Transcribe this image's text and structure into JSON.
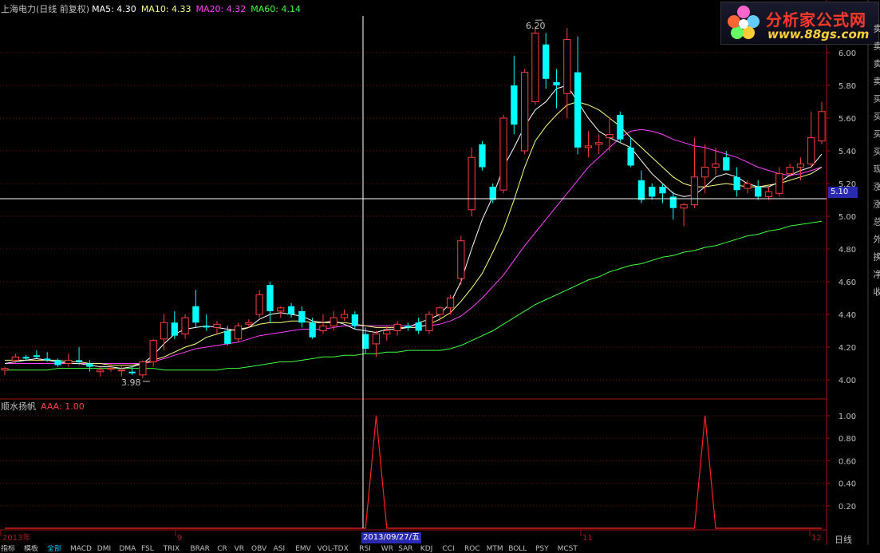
{
  "header": {
    "title": "上海电力(日线 前复权)",
    "ma5": "MA5: 4.30",
    "ma10": "MA10: 4.33",
    "ma20": "MA20: 4.32",
    "ma60": "MA60: 4.14"
  },
  "indicator": {
    "name": "顺水扬帆",
    "value": "AAA: 1.00"
  },
  "logo": {
    "brand": "分析家公式网",
    "url": "www.88gs.com"
  },
  "labels": {
    "high": "6.20",
    "low": "3.98",
    "cursor_price": "5.10",
    "cursor_date": "2013/09/27/五",
    "period": "日线"
  },
  "time_axis": [
    "2013年",
    "9",
    "11",
    "12"
  ],
  "price_axis": [
    "6.00",
    "5.80",
    "5.60",
    "5.40",
    "5.20",
    "5.00",
    "4.80",
    "4.60",
    "4.40",
    "4.20",
    "4.00"
  ],
  "indicator_axis": [
    "1.00",
    "0.80",
    "0.60",
    "0.40",
    "0.20"
  ],
  "side_labels": [
    "卖",
    "卖",
    "卖",
    "卖",
    "买",
    "买",
    "买",
    "买",
    "现",
    "涨",
    "涨",
    "总",
    "外",
    "换",
    "净",
    "收"
  ],
  "bottom_tabs": [
    {
      "label": "指标",
      "selected": false
    },
    {
      "label": "模板",
      "selected": false
    },
    {
      "label": "全部",
      "selected": true
    },
    {
      "label": "MACD",
      "selected": false
    },
    {
      "label": "DMI",
      "selected": false
    },
    {
      "label": "DMA",
      "selected": false
    },
    {
      "label": "FSL",
      "selected": false
    },
    {
      "label": "TRIX",
      "selected": false
    },
    {
      "label": "BRAR",
      "selected": false
    },
    {
      "label": "CR",
      "selected": false
    },
    {
      "label": "VR",
      "selected": false
    },
    {
      "label": "OBV",
      "selected": false
    },
    {
      "label": "ASI",
      "selected": false
    },
    {
      "label": "EMV",
      "selected": false
    },
    {
      "label": "VOL-TDX",
      "selected": false
    },
    {
      "label": "RSI",
      "selected": false
    },
    {
      "label": "WR",
      "selected": false
    },
    {
      "label": "SAR",
      "selected": false
    },
    {
      "label": "KDJ",
      "selected": false
    },
    {
      "label": "CCI",
      "selected": false
    },
    {
      "label": "ROC",
      "selected": false
    },
    {
      "label": "MTM",
      "selected": false
    },
    {
      "label": "BOLL",
      "selected": false
    },
    {
      "label": "PSY",
      "selected": false
    },
    {
      "label": "MCST",
      "selected": false
    }
  ],
  "colors": {
    "up": "#ff3c3c",
    "down": "#00ffff",
    "ma5": "#ffffff",
    "ma10": "#ffff80",
    "ma20": "#ff40ff",
    "ma60": "#40ff40",
    "indicator": "#ff2020",
    "grid": "#7a1010"
  },
  "chart_data": {
    "type": "candlestick",
    "ylim": [
      3.9,
      6.3
    ],
    "candles": [
      [
        4.06,
        4.08,
        4.03,
        4.07
      ],
      [
        4.12,
        4.16,
        4.1,
        4.14
      ],
      [
        4.14,
        4.15,
        4.12,
        4.13
      ],
      [
        4.15,
        4.18,
        4.13,
        4.14
      ],
      [
        4.13,
        4.17,
        4.11,
        4.12
      ],
      [
        4.12,
        4.13,
        4.08,
        4.09
      ],
      [
        4.1,
        4.16,
        4.08,
        4.12
      ],
      [
        4.12,
        4.2,
        4.09,
        4.11
      ],
      [
        4.1,
        4.12,
        4.05,
        4.08
      ],
      [
        4.05,
        4.08,
        4.02,
        4.06
      ],
      [
        4.07,
        4.1,
        4.05,
        4.07
      ],
      [
        4.06,
        4.09,
        4.02,
        4.06
      ],
      [
        4.05,
        4.08,
        4.03,
        4.04
      ],
      [
        4.03,
        4.12,
        4.01,
        4.11
      ],
      [
        4.11,
        4.25,
        4.08,
        4.24
      ],
      [
        4.25,
        4.4,
        4.18,
        4.35
      ],
      [
        4.35,
        4.42,
        4.25,
        4.27
      ],
      [
        4.28,
        4.4,
        4.25,
        4.38
      ],
      [
        4.45,
        4.55,
        4.32,
        4.35
      ],
      [
        4.33,
        4.4,
        4.3,
        4.32
      ],
      [
        4.32,
        4.36,
        4.28,
        4.34
      ],
      [
        4.3,
        4.33,
        4.21,
        4.22
      ],
      [
        4.25,
        4.35,
        4.23,
        4.33
      ],
      [
        4.34,
        4.37,
        4.32,
        4.35
      ],
      [
        4.4,
        4.55,
        4.38,
        4.52
      ],
      [
        4.58,
        4.6,
        4.35,
        4.42
      ],
      [
        4.42,
        4.45,
        4.38,
        4.44
      ],
      [
        4.45,
        4.47,
        4.38,
        4.4
      ],
      [
        4.42,
        4.45,
        4.32,
        4.35
      ],
      [
        4.35,
        4.38,
        4.25,
        4.26
      ],
      [
        4.3,
        4.4,
        4.28,
        4.33
      ],
      [
        4.33,
        4.42,
        4.3,
        4.38
      ],
      [
        4.38,
        4.43,
        4.36,
        4.4
      ],
      [
        4.4,
        4.42,
        4.31,
        4.33
      ],
      [
        4.28,
        4.32,
        4.16,
        4.19
      ],
      [
        4.22,
        4.3,
        4.14,
        4.28
      ],
      [
        4.28,
        4.33,
        4.24,
        4.3
      ],
      [
        4.3,
        4.36,
        4.27,
        4.34
      ],
      [
        4.33,
        4.35,
        4.3,
        4.32
      ],
      [
        4.35,
        4.38,
        4.28,
        4.3
      ],
      [
        4.3,
        4.42,
        4.28,
        4.4
      ],
      [
        4.4,
        4.45,
        4.36,
        4.44
      ],
      [
        4.44,
        4.52,
        4.4,
        4.5
      ],
      [
        4.62,
        4.88,
        4.58,
        4.85
      ],
      [
        5.04,
        5.42,
        5.0,
        5.36
      ],
      [
        5.44,
        5.46,
        5.28,
        5.3
      ],
      [
        5.18,
        5.2,
        5.08,
        5.1
      ],
      [
        5.16,
        5.62,
        5.14,
        5.6
      ],
      [
        5.8,
        5.98,
        5.5,
        5.56
      ],
      [
        5.4,
        5.9,
        5.38,
        5.88
      ],
      [
        5.7,
        6.16,
        5.68,
        6.12
      ],
      [
        6.05,
        6.12,
        5.78,
        5.84
      ],
      [
        5.82,
        5.9,
        5.66,
        5.8
      ],
      [
        5.75,
        6.15,
        5.6,
        6.08
      ],
      [
        5.88,
        6.1,
        5.38,
        5.42
      ],
      [
        5.42,
        5.52,
        5.36,
        5.43
      ],
      [
        5.44,
        5.5,
        5.38,
        5.45
      ],
      [
        5.48,
        5.6,
        5.4,
        5.5
      ],
      [
        5.62,
        5.64,
        5.45,
        5.47
      ],
      [
        5.42,
        5.48,
        5.3,
        5.31
      ],
      [
        5.22,
        5.28,
        5.08,
        5.1
      ],
      [
        5.18,
        5.2,
        5.1,
        5.12
      ],
      [
        5.18,
        5.2,
        5.08,
        5.14
      ],
      [
        5.12,
        5.15,
        4.98,
        5.05
      ],
      [
        5.05,
        5.08,
        4.94,
        5.07
      ],
      [
        5.07,
        5.48,
        5.05,
        5.24
      ],
      [
        5.24,
        5.44,
        5.14,
        5.3
      ],
      [
        5.3,
        5.42,
        5.25,
        5.32
      ],
      [
        5.36,
        5.4,
        5.28,
        5.28
      ],
      [
        5.24,
        5.3,
        5.12,
        5.16
      ],
      [
        5.17,
        5.22,
        5.14,
        5.2
      ],
      [
        5.18,
        5.22,
        5.1,
        5.12
      ],
      [
        5.12,
        5.18,
        5.1,
        5.15
      ],
      [
        5.14,
        5.3,
        5.12,
        5.26
      ],
      [
        5.26,
        5.32,
        5.24,
        5.3
      ],
      [
        5.3,
        5.36,
        5.22,
        5.32
      ],
      [
        5.32,
        5.64,
        5.3,
        5.48
      ],
      [
        5.46,
        5.7,
        5.44,
        5.64
      ]
    ],
    "ma5": [
      4.1,
      4.11,
      4.12,
      4.13,
      4.12,
      4.11,
      4.1,
      4.1,
      4.09,
      4.08,
      4.08,
      4.07,
      4.08,
      4.1,
      4.15,
      4.22,
      4.28,
      4.31,
      4.32,
      4.33,
      4.32,
      4.31,
      4.3,
      4.32,
      4.37,
      4.4,
      4.41,
      4.4,
      4.39,
      4.36,
      4.35,
      4.36,
      4.34,
      4.31,
      4.3,
      4.29,
      4.31,
      4.31,
      4.32,
      4.35,
      4.37,
      4.4,
      4.47,
      4.6,
      4.8,
      4.98,
      5.12,
      5.3,
      5.42,
      5.55,
      5.65,
      5.7,
      5.78,
      5.8,
      5.7,
      5.6,
      5.52,
      5.48,
      5.45,
      5.42,
      5.34,
      5.26,
      5.2,
      5.14,
      5.12,
      5.13,
      5.18,
      5.24,
      5.26,
      5.24,
      5.2,
      5.18,
      5.18,
      5.21,
      5.25,
      5.28,
      5.3,
      5.38
    ],
    "ma10": [
      4.12,
      4.12,
      4.12,
      4.12,
      4.12,
      4.12,
      4.11,
      4.11,
      4.1,
      4.1,
      4.09,
      4.09,
      4.09,
      4.1,
      4.12,
      4.14,
      4.17,
      4.2,
      4.22,
      4.26,
      4.28,
      4.3,
      4.31,
      4.32,
      4.34,
      4.35,
      4.35,
      4.36,
      4.36,
      4.35,
      4.35,
      4.35,
      4.35,
      4.34,
      4.33,
      4.32,
      4.32,
      4.32,
      4.32,
      4.32,
      4.34,
      4.37,
      4.41,
      4.48,
      4.56,
      4.65,
      4.78,
      4.92,
      5.1,
      5.3,
      5.46,
      5.55,
      5.62,
      5.68,
      5.7,
      5.68,
      5.65,
      5.6,
      5.55,
      5.48,
      5.42,
      5.36,
      5.3,
      5.24,
      5.2,
      5.18,
      5.18,
      5.19,
      5.2,
      5.19,
      5.18,
      5.18,
      5.19,
      5.2,
      5.22,
      5.24,
      5.26,
      5.3
    ],
    "ma20": [
      4.1,
      4.1,
      4.1,
      4.1,
      4.1,
      4.1,
      4.1,
      4.1,
      4.1,
      4.1,
      4.1,
      4.1,
      4.1,
      4.1,
      4.11,
      4.13,
      4.15,
      4.17,
      4.19,
      4.2,
      4.21,
      4.22,
      4.23,
      4.25,
      4.27,
      4.28,
      4.29,
      4.3,
      4.31,
      4.31,
      4.31,
      4.32,
      4.33,
      4.33,
      4.33,
      4.33,
      4.33,
      4.33,
      4.33,
      4.33,
      4.33,
      4.34,
      4.36,
      4.39,
      4.44,
      4.5,
      4.57,
      4.64,
      4.73,
      4.82,
      4.9,
      4.98,
      5.06,
      5.14,
      5.22,
      5.3,
      5.36,
      5.42,
      5.48,
      5.52,
      5.53,
      5.52,
      5.5,
      5.47,
      5.45,
      5.43,
      5.42,
      5.4,
      5.38,
      5.36,
      5.33,
      5.3,
      5.28,
      5.26,
      5.25,
      5.26,
      5.28,
      5.3
    ],
    "ma60": [
      4.06,
      4.06,
      4.06,
      4.06,
      4.06,
      4.07,
      4.07,
      4.07,
      4.07,
      4.07,
      4.07,
      4.07,
      4.07,
      4.07,
      4.07,
      4.06,
      4.06,
      4.06,
      4.06,
      4.06,
      4.06,
      4.07,
      4.07,
      4.08,
      4.09,
      4.1,
      4.11,
      4.11,
      4.12,
      4.13,
      4.14,
      4.14,
      4.15,
      4.15,
      4.16,
      4.16,
      4.17,
      4.17,
      4.18,
      4.18,
      4.18,
      4.18,
      4.19,
      4.21,
      4.24,
      4.27,
      4.3,
      4.34,
      4.38,
      4.42,
      4.46,
      4.49,
      4.52,
      4.55,
      4.58,
      4.61,
      4.63,
      4.66,
      4.68,
      4.7,
      4.71,
      4.73,
      4.75,
      4.76,
      4.78,
      4.79,
      4.81,
      4.82,
      4.84,
      4.86,
      4.88,
      4.89,
      4.91,
      4.92,
      4.94,
      4.95,
      4.96,
      4.97
    ],
    "signal": [
      0,
      0,
      0,
      0,
      0,
      0,
      0,
      0,
      0,
      0,
      0,
      0,
      0,
      0,
      0,
      0,
      0,
      0,
      0,
      0,
      0,
      0,
      0,
      0,
      0,
      0,
      0,
      0,
      0,
      0,
      0,
      0,
      0,
      0,
      0,
      1,
      0,
      0,
      0,
      0,
      0,
      0,
      0,
      0,
      0,
      0,
      0,
      0,
      0,
      0,
      0,
      0,
      0,
      0,
      0,
      0,
      0,
      0,
      0,
      0,
      0,
      0,
      0,
      0,
      0,
      0,
      1,
      0,
      0,
      0,
      0,
      0,
      0,
      0,
      0,
      0,
      0,
      0
    ],
    "indicator_ylim": [
      0,
      1.1
    ]
  }
}
